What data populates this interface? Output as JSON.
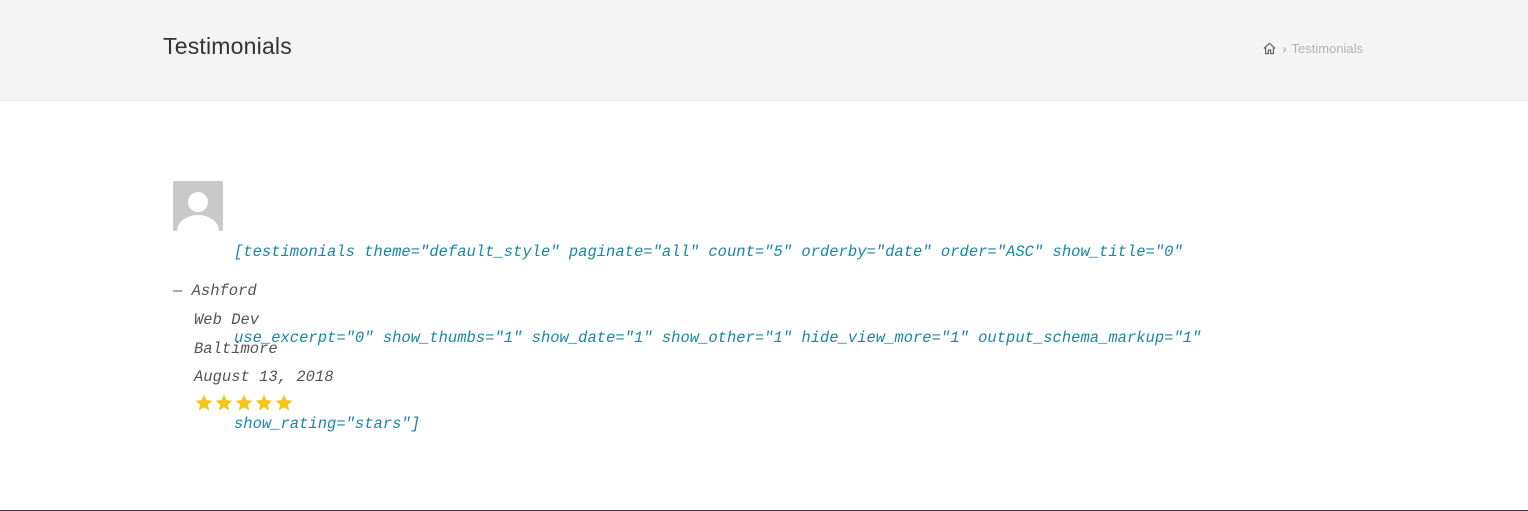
{
  "header": {
    "title": "Testimonials",
    "breadcrumb": {
      "home_icon": "home-icon",
      "separator": "›",
      "current": "Testimonials"
    }
  },
  "testimonial": {
    "avatar_icon": "default-user-avatar",
    "content_lines": [
      "[testimonials theme=\"default_style\" paginate=\"all\" count=\"5\" orderby=\"date\" order=\"ASC\" show_title=\"0\"",
      "use_excerpt=\"0\" show_thumbs=\"1\" show_date=\"1\" show_other=\"1\" hide_view_more=\"1\" output_schema_markup=\"1\"",
      "show_rating=\"stars\"]"
    ],
    "author": "— Ashford",
    "job_title": "Web Dev",
    "location": "Baltimore",
    "date": "August 13, 2018",
    "rating": 5,
    "rating_max": 5,
    "star_color": "#f5c518"
  },
  "colors": {
    "header_bg": "#f4f4f4",
    "link": "#1a86a5",
    "meta_text": "#555555"
  }
}
